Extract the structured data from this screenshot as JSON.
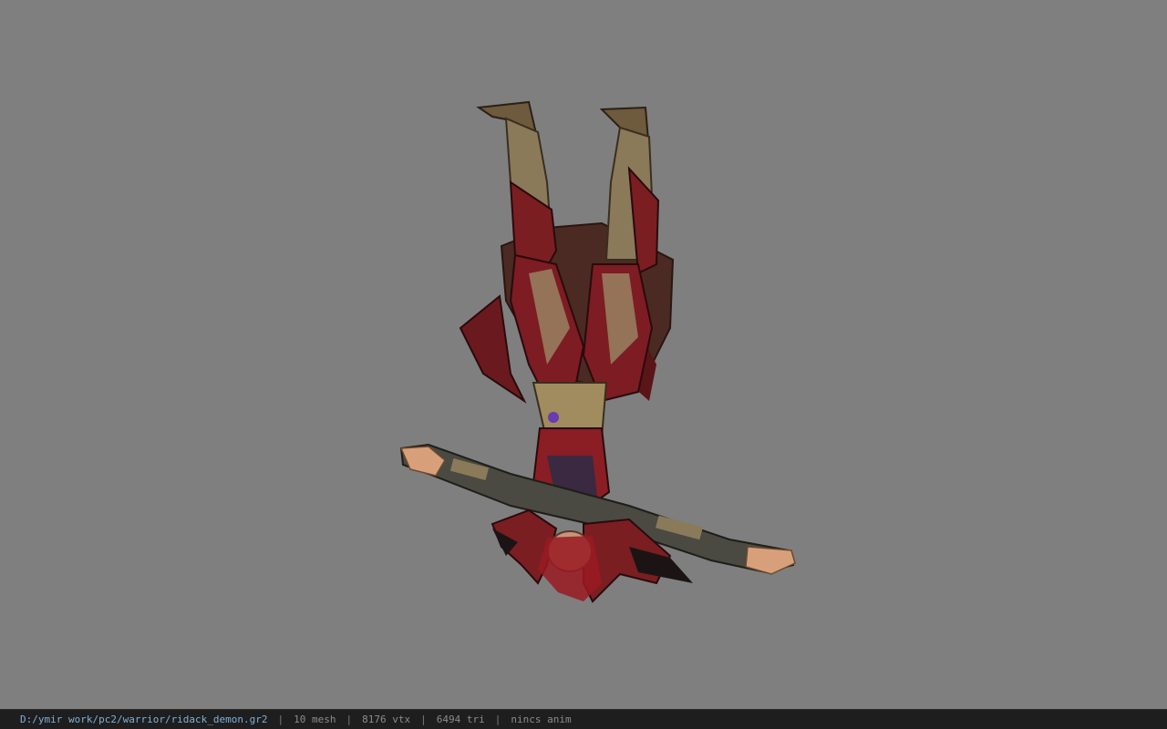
{
  "viewport": {
    "background_color": "#7f7f7f",
    "model_icon": "upside-down-armored-warrior-model"
  },
  "statusbar": {
    "file_path": "D:/ymir work/pc2/warrior/ridack_demon.gr2",
    "separator": "|",
    "mesh_count": "10 mesh",
    "vertex_count": "8176 vtx",
    "triangle_count": "6494 tri",
    "anim_status": "nincs anim",
    "path_color": "#7fb0d6",
    "bar_color": "#1e1e1e"
  }
}
